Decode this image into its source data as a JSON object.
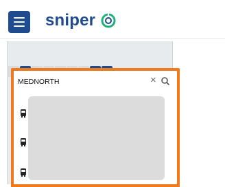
{
  "app": {
    "brand": "sniper"
  },
  "toolbar": {
    "buttons": [
      {
        "icon": "save-icon",
        "enabled": false
      },
      {
        "icon": "folder-icon",
        "enabled": true
      },
      {
        "icon": "add-icon",
        "enabled": false
      },
      {
        "icon": "delete-icon",
        "enabled": false
      },
      {
        "icon": "copy-icon",
        "enabled": false
      },
      {
        "icon": "rewind-icon",
        "enabled": false
      },
      {
        "icon": "fast-forward-icon",
        "enabled": false
      },
      {
        "icon": "bank-icon",
        "enabled": true
      },
      {
        "icon": "info-icon",
        "enabled": true
      }
    ]
  },
  "search": {
    "value": "MEDNORTH",
    "clear_glyph": "×"
  },
  "results": {
    "items": [
      {
        "icon": "bus-icon"
      },
      {
        "icon": "bus-icon"
      },
      {
        "icon": "bus-icon"
      }
    ]
  },
  "colors": {
    "brand": "#1f4b8f",
    "highlight": "#f07a1a",
    "logo_accent": "#22b07d"
  }
}
